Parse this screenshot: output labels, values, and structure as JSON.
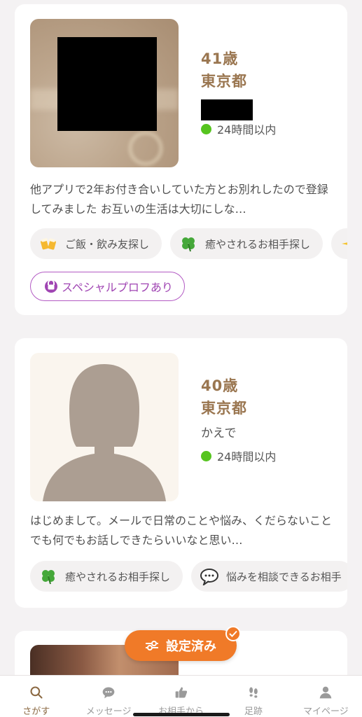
{
  "cards": [
    {
      "age": "41歳",
      "prefecture": "東京都",
      "name": "",
      "status": "24時間以内",
      "bio": "他アプリで2年お付き合いしていた方とお別れしたので登録してみました お互いの生活は大切にしな…",
      "tags": [
        {
          "icon": "beer-cheers-icon",
          "label": "ご飯・飲み友探し"
        },
        {
          "icon": "four-leaf-clover-icon",
          "label": "癒やされるお相手探し"
        },
        {
          "icon": "sparkle-icon",
          "label": ""
        }
      ],
      "special_label": "スペシャルプロフあり"
    },
    {
      "age": "40歳",
      "prefecture": "東京都",
      "name": "かえで",
      "status": "24時間以内",
      "bio": "はじめまして。メールで日常のことや悩み、くだらないことでも何でもお話しできたらいいなと思い…",
      "tags": [
        {
          "icon": "four-leaf-clover-icon",
          "label": "癒やされるお相手探し"
        },
        {
          "icon": "speech-bubble-icon",
          "label": "悩みを相談できるお相手"
        }
      ]
    }
  ],
  "filter_button": {
    "label": "設定済み"
  },
  "tabs": [
    {
      "label": "さがす",
      "icon": "search-icon",
      "active": true
    },
    {
      "label": "メッセージ",
      "icon": "chat-icon",
      "active": false
    },
    {
      "label": "お相手から",
      "icon": "thumbs-up-icon",
      "active": false
    },
    {
      "label": "足跡",
      "icon": "footprints-icon",
      "active": false
    },
    {
      "label": "マイページ",
      "icon": "person-icon",
      "active": false
    }
  ],
  "colors": {
    "accent_brown": "#9a7650",
    "online_green": "#56c41f",
    "fab_orange": "#f07a28",
    "special_purple": "#a045b3"
  }
}
